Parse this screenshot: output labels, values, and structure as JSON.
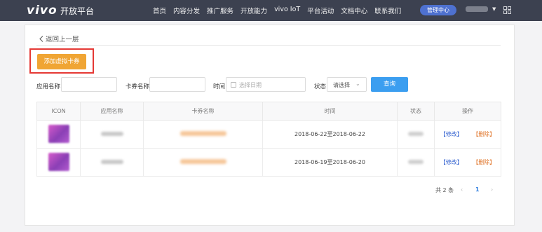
{
  "header": {
    "logo": "vivo",
    "logo_sub": "开放平台",
    "nav": [
      "首页",
      "内容分发",
      "推广服务",
      "开放能力",
      "vivo IoT",
      "平台活动",
      "文档中心",
      "联系我们"
    ],
    "admin_label": "管理中心"
  },
  "page": {
    "back_label": "返回上一层",
    "add_button": "添加虚拟卡券"
  },
  "filters": {
    "app_name_label": "应用名称",
    "coupon_name_label": "卡券名称",
    "time_label": "时间",
    "time_placeholder": "选择日期",
    "status_label": "状态",
    "status_value": "请选择",
    "query_button": "查询"
  },
  "table": {
    "headers": [
      "ICON",
      "应用名称",
      "卡券名称",
      "时间",
      "状态",
      "操作"
    ],
    "rows": [
      {
        "time": "2018-06-22至2018-06-22",
        "edit": "【修改】",
        "delete": "【删除】"
      },
      {
        "time": "2018-06-19至2018-06-20",
        "edit": "【修改】",
        "delete": "【删除】"
      }
    ]
  },
  "pagination": {
    "total": "共 2 条",
    "current_page": "1",
    "prev_icon": "chevron-left-icon",
    "next_icon": "chevron-right-icon"
  },
  "colors": {
    "topbar": "#3c4150",
    "accent_button": "#f0a534",
    "query_button": "#3b9ef0",
    "highlight_frame": "#e53935",
    "link_blue": "#2f5fcf",
    "link_orange": "#e0752a"
  }
}
